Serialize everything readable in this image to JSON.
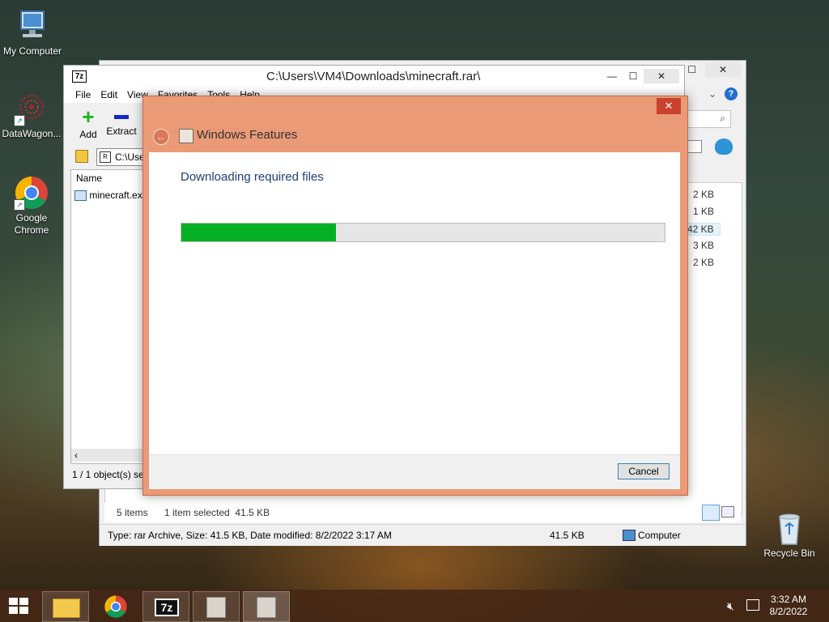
{
  "desktop": {
    "icons": [
      {
        "label": "My Computer"
      },
      {
        "label": "DataWagon..."
      },
      {
        "label": "Google Chrome"
      },
      {
        "label": "Recycle Bin"
      }
    ]
  },
  "explorer": {
    "sizes": [
      "2 KB",
      "1 KB",
      "42 KB",
      "3 KB",
      "2 KB"
    ],
    "items_count": "5 items",
    "selected_info": "1 item selected  41.5 KB",
    "status_type": "Type: rar Archive, Size: 41.5 KB, Date modified: 8/2/2022 3:17 AM",
    "status_size": "41.5 KB",
    "status_location": "Computer"
  },
  "zip": {
    "title": "C:\\Users\\VM4\\Downloads\\minecraft.rar\\",
    "menu": [
      "File",
      "Edit",
      "View",
      "Favorites",
      "Tools",
      "Help"
    ],
    "toolbar_add": "Add",
    "toolbar_extract": "Extract",
    "address": "C:\\Use",
    "column_name": "Name",
    "file_name": "minecraft.exe",
    "status": "1 / 1 object(s) sel",
    "app_icon_text": "7z"
  },
  "dialog": {
    "title": "Windows Features",
    "heading": "Downloading required files",
    "progress": 0.32,
    "cancel_label": "Cancel"
  },
  "taskbar": {
    "time": "3:32 AM",
    "date": "8/2/2022",
    "zip_text": "7z"
  },
  "colors": {
    "dialog_frame": "#ea9a76",
    "progress_fill": "#06b025",
    "heading_text": "#1e3f7a"
  }
}
